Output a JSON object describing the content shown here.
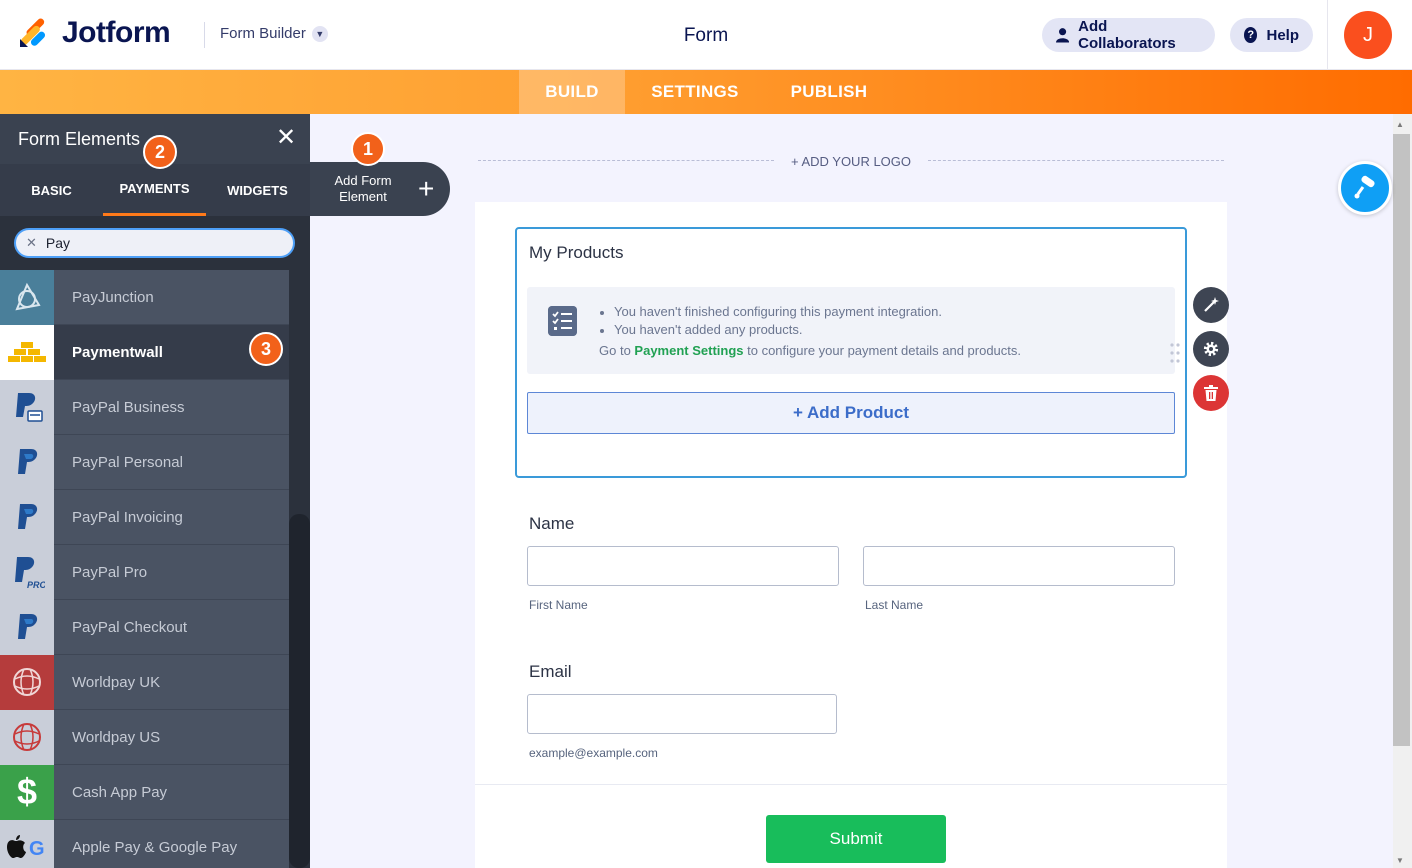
{
  "header": {
    "logo_text": "Jotform",
    "builder_mode": "Form Builder",
    "form_title": "Form",
    "add_collaborators": "Add Collaborators",
    "help": "Help",
    "avatar_initial": "J"
  },
  "nav": {
    "build": "BUILD",
    "settings": "SETTINGS",
    "publish": "PUBLISH"
  },
  "panel": {
    "title": "Form Elements",
    "tabs": [
      "BASIC",
      "PAYMENTS",
      "WIDGETS"
    ],
    "active_tab": "PAYMENTS",
    "search_value": "Pay",
    "items": [
      {
        "label": "PayJunction",
        "icon": "payjunction-icon"
      },
      {
        "label": "Paymentwall",
        "icon": "paymentwall-icon",
        "selected": true
      },
      {
        "label": "PayPal Business",
        "icon": "paypal-business-icon"
      },
      {
        "label": "PayPal Personal",
        "icon": "paypal-icon"
      },
      {
        "label": "PayPal Invoicing",
        "icon": "paypal-icon"
      },
      {
        "label": "PayPal Pro",
        "icon": "paypal-pro-icon"
      },
      {
        "label": "PayPal Checkout",
        "icon": "paypal-icon"
      },
      {
        "label": "Worldpay UK",
        "icon": "worldpay-icon"
      },
      {
        "label": "Worldpay US",
        "icon": "worldpay-icon"
      },
      {
        "label": "Cash App Pay",
        "icon": "cash-app-icon"
      },
      {
        "label": "Apple Pay & Google Pay",
        "icon": "apple-google-pay-icon"
      }
    ]
  },
  "badges": {
    "one": "1",
    "two": "2",
    "three": "3"
  },
  "add_element": {
    "label": "Add Form Element",
    "plus": "+"
  },
  "canvas": {
    "add_logo": "+ ADD YOUR LOGO",
    "products": {
      "title": "My Products",
      "notice_lines": [
        "You haven't finished configuring this payment integration.",
        "You haven't added any products."
      ],
      "goto_prefix": "Go to ",
      "goto_link": "Payment Settings",
      "goto_suffix": " to configure your payment details and products.",
      "add_product": "+ Add Product"
    },
    "name_field": {
      "label": "Name",
      "first_sub": "First Name",
      "last_sub": "Last Name"
    },
    "email_field": {
      "label": "Email",
      "sub": "example@example.com"
    },
    "submit": "Submit"
  },
  "colors": {
    "accent_orange": "#ff6c00",
    "panel_bg": "#353c4a",
    "submit_green": "#18bd5b",
    "selected_border": "#3a9ad9",
    "designer_blue": "#0f9ff5"
  }
}
